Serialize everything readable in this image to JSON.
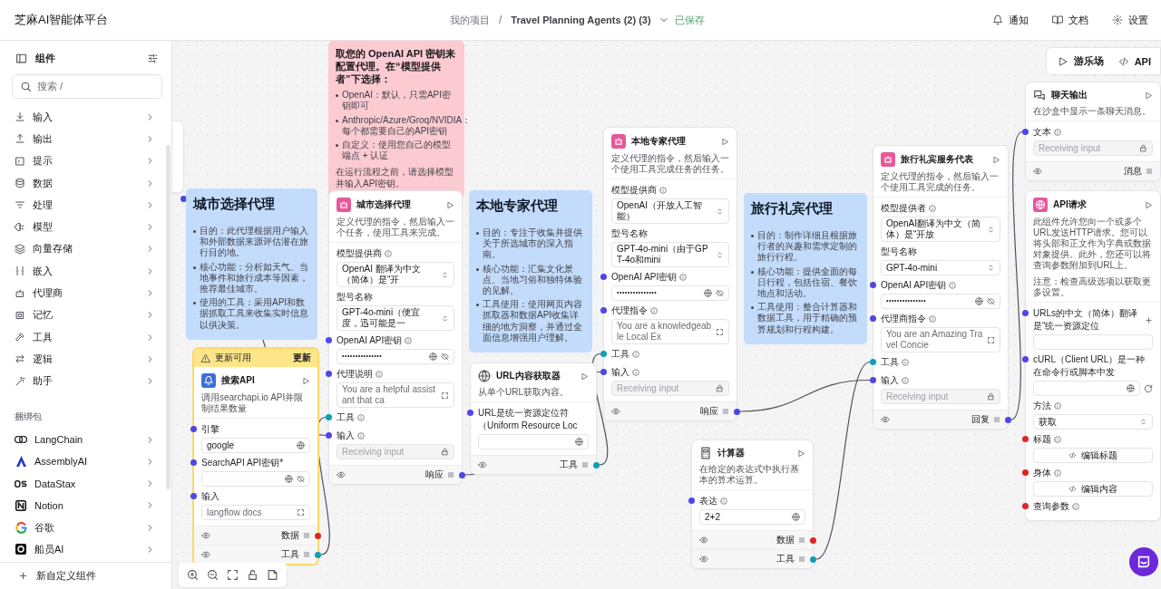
{
  "header": {
    "app_title": "芝麻AI智能体平台",
    "breadcrumb": {
      "project": "我的项目",
      "separator": "/",
      "flow": "Travel Planning Agents (2) (3)",
      "status": "已保存"
    },
    "actions": [
      {
        "label": "通知"
      },
      {
        "label": "文档"
      },
      {
        "label": "设置"
      }
    ]
  },
  "sidebar": {
    "title": "组件",
    "search": {
      "placeholder": "搜索 /"
    },
    "categories": [
      {
        "label": "输入"
      },
      {
        "label": "输出"
      },
      {
        "label": "提示"
      },
      {
        "label": "数据"
      },
      {
        "label": "处理"
      },
      {
        "label": "模型"
      },
      {
        "label": "向量存储"
      },
      {
        "label": "嵌入"
      },
      {
        "label": "代理商"
      },
      {
        "label": "记忆"
      },
      {
        "label": "工具"
      },
      {
        "label": "逻辑"
      },
      {
        "label": "助手"
      }
    ],
    "bundles_title": "捆绑包",
    "bundles": [
      {
        "label": "LangChain"
      },
      {
        "label": "AssemblyAI"
      },
      {
        "label": "DataStax"
      },
      {
        "label": "Notion"
      },
      {
        "label": "谷歌"
      },
      {
        "label": "船员AI"
      }
    ],
    "footer": "新自定义组件"
  },
  "canvas": {
    "toolbar": [
      {
        "label": "游乐场"
      },
      {
        "label": "API"
      }
    ],
    "nodes": [
      {
        "kind": "stub",
        "outputs": [
          {
            "color": "#4f46e5"
          }
        ]
      },
      {
        "kind": "note",
        "color": "#c3dcfb",
        "title": "城市选择代理",
        "bullets": [
          "目的：此代理根据用户输入和外部数据来源评估潜在旅行目的地。",
          "核心功能：分析如天气、当地事件和旅行成本等因素，推荐最佳城市。",
          "使用的工具：采用API和数据抓取工具来收集实时信息以供决策。"
        ]
      },
      {
        "kind": "note",
        "color": "#fccbd2",
        "heading": "取您的 OpenAI API 密钥来配置代理。在“模型提供者”下选择：",
        "bullets": [
          "OpenAI：默认，只需API密钥即可",
          "Anthropic/Azure/Groq/NVIDIA：每个都需要自己的API密钥",
          "自定义：使用您自己的模型端点 + 认证"
        ],
        "footer": "在运行流程之前，请选择模型并输入API密钥。"
      },
      {
        "kind": "agent",
        "title": "城市选择代理",
        "description": "定义代理的指令，然后输入一个任务，使用工具来完成。",
        "fields": [
          {
            "label": "模型提供商",
            "info": true,
            "kind": "select",
            "value": "OpenAI 翻译为中文（简体）是“开"
          },
          {
            "label": "型号名称",
            "kind": "select",
            "value": "GPT-4o-mini（便宜度，迅可能是一"
          },
          {
            "label": "OpenAI API密钥",
            "info": true,
            "kind": "password",
            "value": "•••••••••••••••",
            "handle": {
              "color": "#4f46e5"
            }
          },
          {
            "label": "代理说明",
            "info": true,
            "kind": "prompt",
            "value": "You are a helpful assistant that ca",
            "handle": {
              "color": "#4f46e5"
            }
          },
          {
            "label": "工具",
            "info": true,
            "kind": "none",
            "handle": {
              "color": "#0e9fb5"
            }
          },
          {
            "label": "输入",
            "info": true,
            "kind": "readonly",
            "placeholder": "Receiving input",
            "handle": {
              "color": "#4f46e5"
            }
          }
        ],
        "outputs": [
          {
            "label": "响应",
            "color": "#4f46e5"
          }
        ]
      },
      {
        "kind": "search",
        "banner": {
          "text": "更新可用",
          "action": "更新"
        },
        "title": "搜索API",
        "description": "调用searchapi.io API并限制结果数量",
        "fields": [
          {
            "label": "引擎",
            "kind": "text",
            "value": "google",
            "handle": {
              "color": "#4f46e5"
            }
          },
          {
            "label": "SearchAPI API密钥*",
            "kind": "password",
            "handle": {
              "color": "#4f46e5"
            }
          },
          {
            "label": "输入",
            "kind": "text_expand",
            "value": "langflow docs",
            "handle": {
              "color": "#4f46e5"
            }
          }
        ],
        "outputs": [
          {
            "label": "数据",
            "color": "#dc2626"
          },
          {
            "label": "工具",
            "color": "#0e9fb5"
          }
        ]
      },
      {
        "kind": "note",
        "color": "#c3dcfb",
        "title": "本地专家代理",
        "bullets": [
          "目的：专注于收集并提供关于所选城市的深入指南。",
          "核心功能：汇集文化景点、当地习俗和独特体验的见解。",
          "工具使用：使用网页内容抓取器和数据API收集详细的地方洞察，并通过全面信息增强用户理解。"
        ]
      },
      {
        "kind": "fetch",
        "title": "URL内容获取器",
        "description": "从单个URL获取内容。",
        "fields": [
          {
            "label": "URL是统一资源定位符（Uniform Resource Loc",
            "kind": "text",
            "handle": {
              "color": "#4f46e5"
            }
          }
        ],
        "outputs": [
          {
            "label": "工具",
            "color": "#0e9fb5"
          }
        ]
      },
      {
        "kind": "agent",
        "title": "本地专家代理",
        "description": "定义代理的指令，然后输入一个使用工具完成任务的任务。",
        "fields": [
          {
            "label": "模型提供商",
            "info": true,
            "kind": "select",
            "value": "OpenAI（开放人工智能）"
          },
          {
            "label": "型号名称",
            "kind": "select",
            "value": "GPT-4o-mini（由于GPT-4o和mini"
          },
          {
            "label": "OpenAI API密钥",
            "info": true,
            "kind": "password",
            "value": "•••••••••••••••",
            "handle": {
              "color": "#4f46e5"
            }
          },
          {
            "label": "代理指令",
            "info": true,
            "kind": "prompt",
            "value": "You are a knowledgeable Local Ex",
            "handle": {
              "color": "#4f46e5"
            }
          },
          {
            "label": "工具",
            "info": true,
            "kind": "none",
            "handle": {
              "color": "#0e9fb5"
            }
          },
          {
            "label": "输入",
            "info": true,
            "kind": "readonly",
            "placeholder": "Receiving input",
            "handle": {
              "color": "#4f46e5"
            }
          }
        ],
        "outputs": [
          {
            "label": "响应",
            "color": "#4f46e5"
          }
        ]
      },
      {
        "kind": "calculator",
        "title": "计算器",
        "description": "在给定的表达式中执行基本的算术运算。",
        "fields": [
          {
            "label": "表达",
            "info": true,
            "kind": "text",
            "value": "2+2",
            "handle": {
              "color": "#4f46e5"
            }
          }
        ],
        "outputs": [
          {
            "label": "数据",
            "color": "#dc2626"
          },
          {
            "label": "工具",
            "color": "#0e9fb5"
          }
        ]
      },
      {
        "kind": "note",
        "color": "#c3dcfb",
        "title": "旅行礼宾代理",
        "bullets": [
          "目的：制作详细且根据旅行者的兴趣和需求定制的旅行行程。",
          "核心功能：提供全面的每日行程，包括住宿、餐饮地点和活动。",
          "工具使用：整合计算器和数据工具，用于精确的预算规划和行程构建。"
        ]
      },
      {
        "kind": "agent",
        "title": "旅行礼宾服务代表",
        "description": "定义代理的指令，然后输入一个使用工具完成的任务。",
        "fields": [
          {
            "label": "模型提供者",
            "info": true,
            "kind": "select",
            "value": "OpenAI翻译为中文（简体）是“开放"
          },
          {
            "label": "型号名称",
            "kind": "select",
            "value": "GPT-4o-mini"
          },
          {
            "label": "OpenAI API密钥",
            "info": true,
            "kind": "password",
            "value": "•••••••••••••••",
            "handle": {
              "color": "#4f46e5"
            }
          },
          {
            "label": "代理商指令",
            "info": true,
            "kind": "prompt",
            "value": "You are an Amazing Travel Concie",
            "handle": {
              "color": "#4f46e5"
            }
          },
          {
            "label": "工具",
            "info": true,
            "kind": "none",
            "handle": {
              "color": "#0e9fb5"
            }
          },
          {
            "label": "输入",
            "info": true,
            "kind": "readonly",
            "placeholder": "Receiving input",
            "handle": {
              "color": "#4f46e5"
            }
          }
        ],
        "outputs": [
          {
            "label": "回复",
            "color": "#4f46e5"
          }
        ]
      },
      {
        "kind": "chat_output",
        "title": "聊天输出",
        "description": "在沙盒中显示一条聊天消息。",
        "fields": [
          {
            "label": "文本",
            "info": true,
            "kind": "readonly",
            "placeholder": "Receiving input",
            "handle": {
              "color": "#4f46e5"
            }
          }
        ],
        "outputs": [
          {
            "label": "消息"
          }
        ]
      },
      {
        "kind": "api_request",
        "title": "API请求",
        "description": "此组件允许您向一个或多个URL发送HTTP请求。您可以将头部和正文作为字典或数据对象提供。此外，您还可以将查询参数附加到URL上。",
        "note": "注意：检查高级选项以获取更多设置。",
        "fields": [
          {
            "label": "URLs的中文（简体）翻译是“统一资源定位",
            "add": true,
            "kind": "text_plain",
            "handle": {
              "color": "#4f46e5"
            }
          },
          {
            "label": "cURL（Client URL）是一种在命令行或脚本中发",
            "kind": "text_refresh",
            "handle": {
              "color": "#4f46e5"
            }
          },
          {
            "label": "方法",
            "info": true,
            "kind": "select",
            "value": "获取"
          },
          {
            "label": "标题",
            "info": true,
            "kind": "button",
            "value": "编辑标题",
            "handle": {
              "color": "#dc2626"
            }
          },
          {
            "label": "身体",
            "info": true,
            "kind": "button",
            "value": "编辑内容",
            "handle": {
              "color": "#dc2626"
            }
          },
          {
            "label": "查询参数",
            "info": true,
            "kind": "none",
            "handle": {
              "color": "#dc2626"
            }
          }
        ]
      }
    ]
  }
}
